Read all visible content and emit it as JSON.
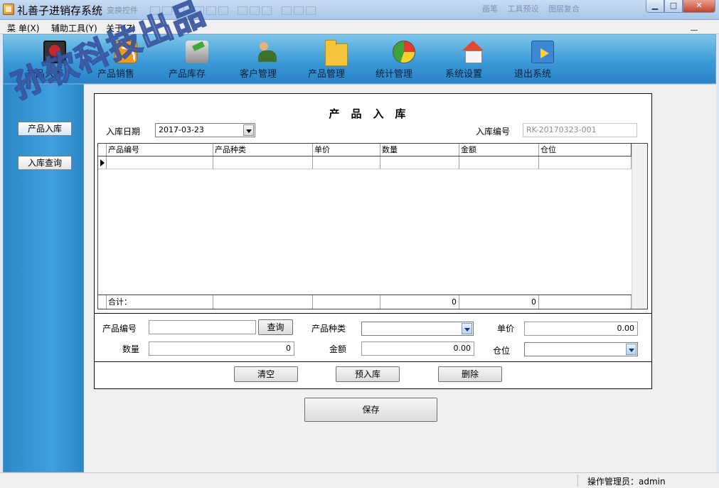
{
  "window": {
    "title": "礼善子进销存系统",
    "ghost_toolbar_text": "变换控件",
    "ghost_right": [
      "画笔",
      "工具预设",
      "图层复合"
    ],
    "controls": {
      "minimize": "▁",
      "maximize": "□",
      "close": "✕"
    }
  },
  "menu": [
    "菜 单(X)",
    "辅助工具(Y)",
    "关于(Z)"
  ],
  "toolbar": [
    {
      "label": "产品入库",
      "icon": "monitor-icon"
    },
    {
      "label": "产品销售",
      "icon": "rss-icon"
    },
    {
      "label": "产品库存",
      "icon": "car-icon"
    },
    {
      "label": "客户管理",
      "icon": "users-icon"
    },
    {
      "label": "产品管理",
      "icon": "folder-icon"
    },
    {
      "label": "统计管理",
      "icon": "pie-chart-icon"
    },
    {
      "label": "系统设置",
      "icon": "house-icon"
    },
    {
      "label": "退出系统",
      "icon": "exit-icon"
    }
  ],
  "leftnav": [
    "产品入库",
    "入库查询"
  ],
  "form": {
    "title": "产品入库",
    "date_label": "入库日期",
    "date_value": "2017-03-23",
    "code_label": "入库编号",
    "code_value": "RK-20170323-001"
  },
  "grid": {
    "columns": [
      "产品编号",
      "产品种类",
      "单价",
      "数量",
      "金额",
      "仓位"
    ],
    "footer": {
      "label": "合计：",
      "quantity": "0",
      "amount": "0"
    }
  },
  "entry": {
    "product_code_label": "产品编号",
    "product_code_value": "",
    "query_button": "查询",
    "category_label": "产品种类",
    "category_value": "",
    "price_label": "单价",
    "price_value": "0.00",
    "quantity_label": "数量",
    "quantity_value": "0",
    "amount_label": "金额",
    "amount_value": "0.00",
    "location_label": "仓位",
    "location_value": ""
  },
  "actions": {
    "clear": "清空",
    "pre_stock": "预入库",
    "delete": "删除",
    "save": "保存"
  },
  "status": {
    "operator": "操作管理员：admin"
  },
  "watermark": "孙软科技出品"
}
